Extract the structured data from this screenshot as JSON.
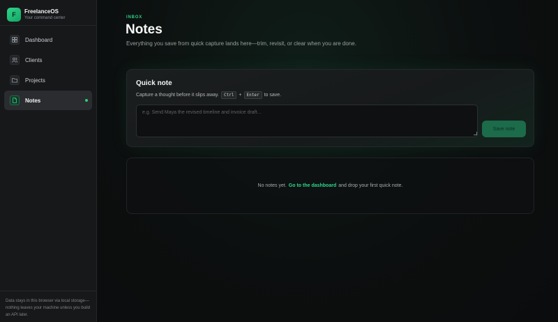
{
  "brand": {
    "logo_letter": "F",
    "name": "FreelanceOS",
    "tagline": "Your command center"
  },
  "sidebar": {
    "items": [
      {
        "label": "Dashboard",
        "icon": "grid-icon",
        "active": false
      },
      {
        "label": "Clients",
        "icon": "users-icon",
        "active": false
      },
      {
        "label": "Projects",
        "icon": "folder-icon",
        "active": false
      },
      {
        "label": "Notes",
        "icon": "document-icon",
        "active": true
      }
    ],
    "footer": "Data stays in this browser via local storage—nothing leaves your machine unless you build an API later."
  },
  "header": {
    "eyebrow": "INBOX",
    "title": "Notes",
    "description": "Everything you save from quick capture lands here—trim, revisit, or clear when you are done."
  },
  "quick_note": {
    "title": "Quick note",
    "hint_prefix": "Capture a thought before it slips away.",
    "key1": "Ctrl",
    "plus": "+",
    "key2": "Enter",
    "hint_suffix": "to save.",
    "placeholder": "e.g. Send Maya the revised timeline and invoice draft...",
    "value": "",
    "save_label": "Save note"
  },
  "empty_state": {
    "prefix": "No notes yet.",
    "link": "Go to the dashboard",
    "suffix": "and drop your first quick note."
  },
  "colors": {
    "accent": "#2fd58a",
    "sidebar_bg": "#17181a",
    "main_bg": "#0b0c0d",
    "save_button_bg": "#1c6b4b"
  }
}
